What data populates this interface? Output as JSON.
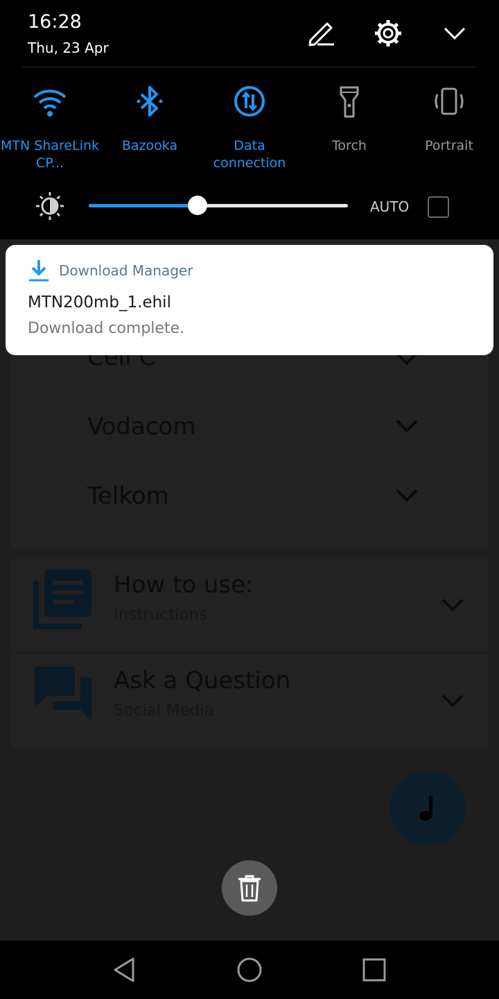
{
  "status": {
    "time": "16:28",
    "date": "Thu, 23 Apr"
  },
  "header_icons": [
    "edit-icon",
    "settings-gear-icon",
    "collapse-chevron-icon"
  ],
  "tiles": [
    {
      "name": "wifi",
      "label": "MTN ShareLink CP...",
      "icon": "wifi-icon",
      "state": "on"
    },
    {
      "name": "bluetooth",
      "label": "Bazooka",
      "icon": "bluetooth-icon",
      "state": "on"
    },
    {
      "name": "data",
      "label": "Data connection",
      "icon": "data-connection-icon",
      "state": "on"
    },
    {
      "name": "torch",
      "label": "Torch",
      "icon": "torch-icon",
      "state": "off"
    },
    {
      "name": "rotation",
      "label": "Portrait",
      "icon": "portrait-icon",
      "state": "off"
    }
  ],
  "brightness": {
    "level": 0.42,
    "auto_label": "AUTO",
    "auto_checked": false
  },
  "notification": {
    "app": "Download Manager",
    "title": "MTN200mb_1.ehil",
    "text": "Download complete."
  },
  "background_app": {
    "carriers": [
      "Cell C",
      "Vodacom",
      "Telkom"
    ],
    "how_to": {
      "title": "How to use:",
      "subtitle": "Instructions"
    },
    "ask": {
      "title": "Ask a Question",
      "subtitle": "Social Media"
    }
  },
  "colors": {
    "accent": "#2196f3",
    "shade": "#000000",
    "notification_app": "#5f7686"
  }
}
